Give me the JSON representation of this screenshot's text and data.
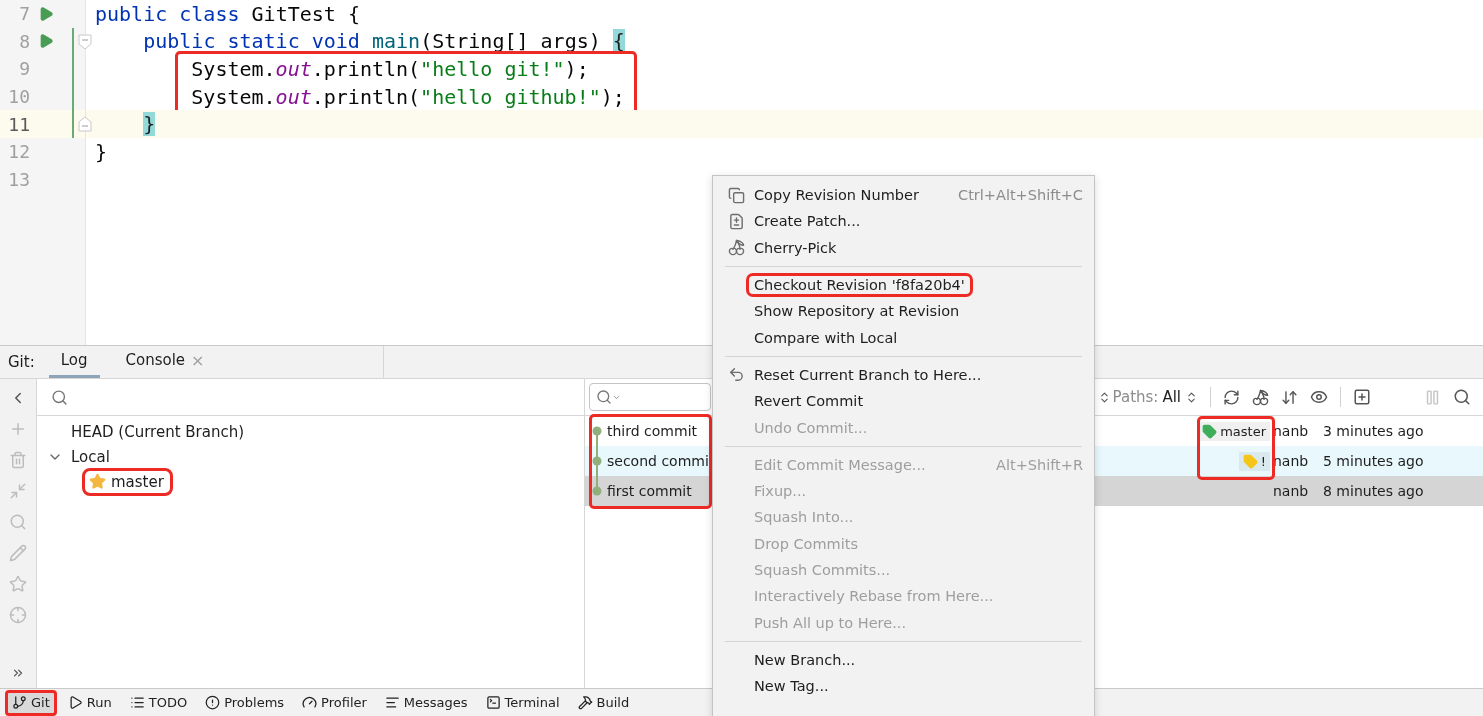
{
  "editor": {
    "lines": [
      {
        "number": "7",
        "kind": "plain",
        "runnable": true,
        "changed": false,
        "current": false,
        "marked": false,
        "tokens": [
          {
            "kind": "keyword",
            "text": "public class"
          },
          {
            "kind": "plain",
            "text": " GitTest {"
          }
        ]
      },
      {
        "number": "8",
        "kind": "fold_start",
        "runnable": true,
        "changed": true,
        "current": false,
        "marked": false,
        "tokens": [
          {
            "kind": "keyword",
            "text": "    public static void"
          },
          {
            "kind": "method",
            "text": " main"
          },
          {
            "kind": "plain",
            "text": "(String[] args) "
          },
          {
            "kind": "match",
            "text": "{"
          }
        ]
      },
      {
        "number": "9",
        "kind": "plain",
        "runnable": false,
        "changed": true,
        "current": false,
        "marked": true,
        "tokens": [
          {
            "kind": "plain",
            "text": "        System."
          },
          {
            "kind": "field",
            "text": "out"
          },
          {
            "kind": "plain",
            "text": ".println("
          },
          {
            "kind": "string",
            "text": "\"hello git!\""
          },
          {
            "kind": "plain",
            "text": ");"
          }
        ]
      },
      {
        "number": "10",
        "kind": "plain",
        "runnable": false,
        "changed": true,
        "current": false,
        "marked": true,
        "tokens": [
          {
            "kind": "plain",
            "text": "        System."
          },
          {
            "kind": "field",
            "text": "out"
          },
          {
            "kind": "plain",
            "text": ".println("
          },
          {
            "kind": "string",
            "text": "\"hello github!\""
          },
          {
            "kind": "plain",
            "text": ");"
          }
        ]
      },
      {
        "number": "11",
        "kind": "fold_end",
        "runnable": false,
        "changed": true,
        "current": true,
        "marked": false,
        "tokens": [
          {
            "kind": "match",
            "text": "    }"
          }
        ]
      },
      {
        "number": "12",
        "kind": "plain",
        "current": false,
        "tokens": [
          {
            "kind": "plain",
            "text": "}"
          }
        ]
      },
      {
        "number": "13",
        "kind": "plain",
        "current": false
      }
    ]
  },
  "tool_window": {
    "title": "Git:",
    "tabs": [
      {
        "label": "Log",
        "selected": true,
        "closable": false
      },
      {
        "label": "Console",
        "selected": false,
        "closable": true
      }
    ],
    "close_glyph": "×"
  },
  "branches": {
    "tree": [
      {
        "label": "HEAD (Current Branch)",
        "favorite": false,
        "marked": false
      },
      {
        "label": "Local",
        "expanded": true,
        "favorite": false,
        "marked": false,
        "children": [
          {
            "label": "master",
            "favorite": true,
            "marked": true
          }
        ]
      }
    ]
  },
  "commits": {
    "paths_label": "Paths:",
    "paths_value": "All",
    "messages_marked": true,
    "refs_marked": true,
    "rows": [
      {
        "message": "third commit",
        "refs": [
          {
            "label": "master",
            "color": "#3fae5a"
          }
        ],
        "author": "nanb",
        "date": "3 minutes ago",
        "selected": false,
        "hovered": false
      },
      {
        "message": "second commi",
        "refs": [
          {
            "label": "!",
            "color": "#f5c518"
          }
        ],
        "author": "nanb",
        "date": "5 minutes ago",
        "selected": false,
        "hovered": true
      },
      {
        "message": "first commit",
        "refs": [],
        "author": "nanb",
        "date": "8 minutes ago",
        "selected": true,
        "hovered": false
      }
    ]
  },
  "context_menu": {
    "groups": [
      [
        {
          "label": "Copy Revision Number",
          "shortcut": "Ctrl+Alt+Shift+C",
          "disabled": false,
          "marked": false
        },
        {
          "label": "Create Patch...",
          "disabled": false,
          "marked": false
        },
        {
          "label": "Cherry-Pick",
          "disabled": false,
          "marked": false
        }
      ],
      [
        {
          "label": "Checkout Revision 'f8fa20b4'",
          "disabled": false,
          "marked": true
        },
        {
          "label": "Show Repository at Revision",
          "disabled": false,
          "marked": false
        },
        {
          "label": "Compare with Local",
          "disabled": false,
          "marked": false
        }
      ],
      [
        {
          "label": "Reset Current Branch to Here...",
          "disabled": false,
          "marked": false
        },
        {
          "label": "Revert Commit",
          "disabled": false,
          "marked": false
        },
        {
          "label": "Undo Commit...",
          "disabled": true,
          "marked": false
        }
      ],
      [
        {
          "label": "Edit Commit Message...",
          "shortcut": "Alt+Shift+R",
          "disabled": true,
          "marked": false
        },
        {
          "label": "Fixup...",
          "disabled": true,
          "marked": false
        },
        {
          "label": "Squash Into...",
          "disabled": true,
          "marked": false
        },
        {
          "label": "Drop Commits",
          "disabled": true,
          "marked": false
        },
        {
          "label": "Squash Commits...",
          "disabled": true,
          "marked": false
        },
        {
          "label": "Interactively Rebase from Here...",
          "disabled": true,
          "marked": false
        },
        {
          "label": "Push All up to Here...",
          "disabled": true,
          "marked": false
        }
      ],
      [
        {
          "label": "New Branch...",
          "disabled": false,
          "marked": false
        },
        {
          "label": "New Tag...",
          "disabled": false,
          "marked": false
        }
      ]
    ]
  },
  "status_bar": {
    "items": [
      {
        "label": "Git",
        "selected": true,
        "marked": true
      },
      {
        "label": "Run",
        "selected": false,
        "marked": false
      },
      {
        "label": "TODO",
        "selected": false,
        "marked": false
      },
      {
        "label": "Problems",
        "selected": false,
        "marked": false
      },
      {
        "label": "Profiler",
        "selected": false,
        "marked": false
      },
      {
        "label": "Messages",
        "selected": false,
        "marked": false
      },
      {
        "label": "Terminal",
        "selected": false,
        "marked": false
      },
      {
        "label": "Build",
        "selected": false,
        "marked": false
      }
    ]
  }
}
